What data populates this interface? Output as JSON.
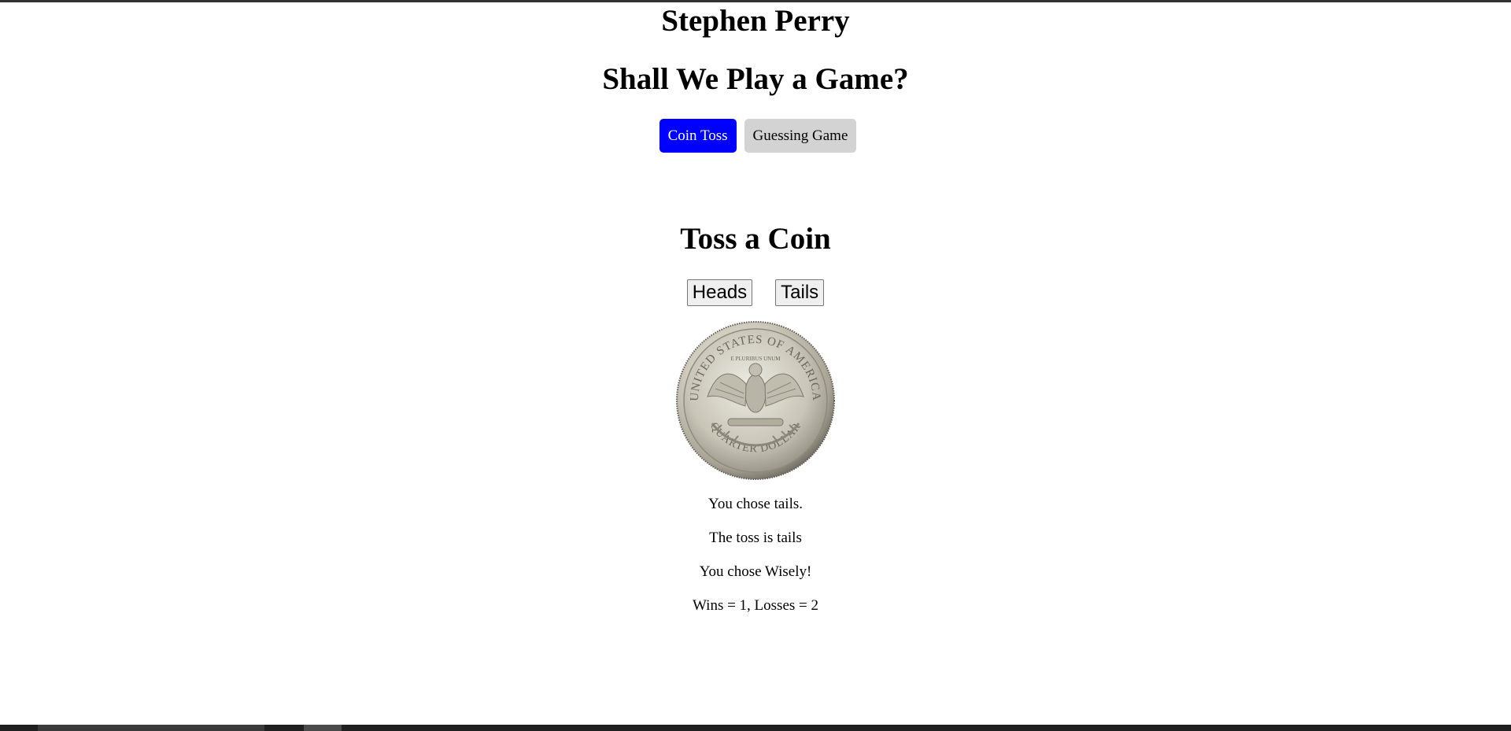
{
  "header": {
    "site_title": "Stephen Perry",
    "subtitle": "Shall We Play a Game?"
  },
  "nav": {
    "items": [
      {
        "label": "Coin Toss",
        "active": true
      },
      {
        "label": "Guessing Game",
        "active": false
      }
    ],
    "active_color": "#0000ff",
    "inactive_color": "#d3d3d3"
  },
  "game": {
    "title": "Toss a Coin",
    "heads_label": "Heads",
    "tails_label": "Tails",
    "coin": {
      "icon": "quarter-dollar-tails-icon",
      "top_text": "UNITED STATES OF AMERICA",
      "bottom_text": "QUARTER DOLLAR",
      "motto": "E PLURIBUS UNUM"
    },
    "results": {
      "choice_text": "You chose tails.",
      "toss_text": "The toss is tails",
      "verdict_text": "You chose Wisely!",
      "score_text": "Wins = 1, Losses = 2"
    }
  }
}
